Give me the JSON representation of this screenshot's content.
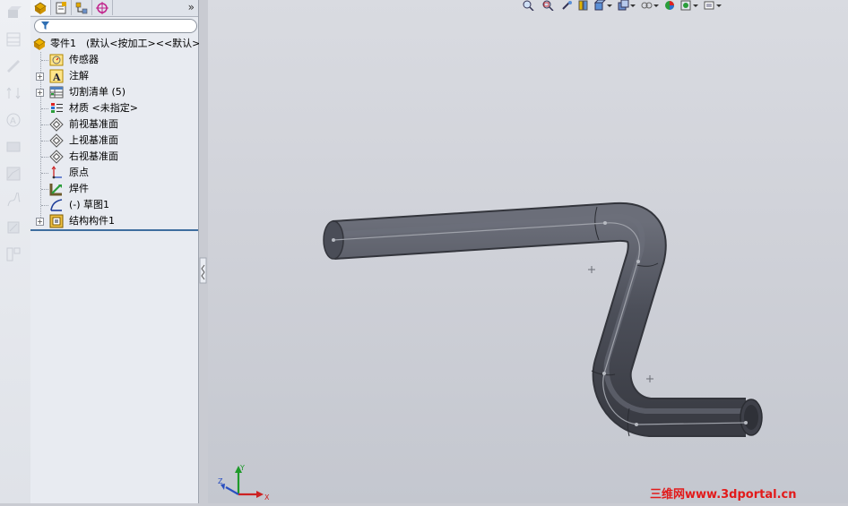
{
  "feature_tree": {
    "root": "零件1　(默认<按加工><<默认>",
    "items": [
      {
        "label": "传感器",
        "icon": "sensor-icon"
      },
      {
        "label": "注解",
        "icon": "annotation-icon"
      },
      {
        "label": "切割清单 (5)",
        "icon": "cut-list-icon"
      },
      {
        "label": "材质 <未指定>",
        "icon": "material-icon"
      },
      {
        "label": "前视基准面",
        "icon": "plane-icon"
      },
      {
        "label": "上视基准面",
        "icon": "plane-icon"
      },
      {
        "label": "右视基准面",
        "icon": "plane-icon"
      },
      {
        "label": "原点",
        "icon": "origin-icon"
      },
      {
        "label": "焊件",
        "icon": "weldment-icon"
      },
      {
        "label": "(-) 草图1",
        "icon": "sketch-icon"
      },
      {
        "label": "结构构件1",
        "icon": "structural-member-icon"
      }
    ]
  },
  "panel": {
    "expand_glyph": "»"
  },
  "triad": {
    "x": "X",
    "y": "Y",
    "z": "Z"
  },
  "watermark": "三维网www.3dportal.cn",
  "colors": {
    "accent": "#3e6e9f",
    "pipe": "#4b4e58",
    "watermark": "#e21a1a"
  }
}
